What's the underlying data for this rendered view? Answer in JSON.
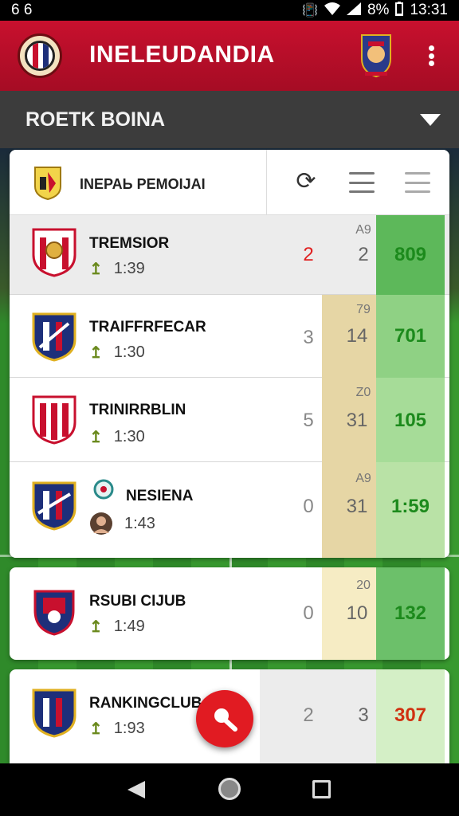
{
  "status_bar": {
    "left": "6 6",
    "battery": "8%",
    "time": "13:31",
    "icons": [
      "vibrate-icon",
      "wifi-icon",
      "signal-icon",
      "battery-icon"
    ]
  },
  "app_bar": {
    "title": "INELEUDANDIA",
    "logo": "club-logo",
    "crest": "crest-icon",
    "menu": "more-vert-icon"
  },
  "dropdown": {
    "label": "ROETK BOINA",
    "icon": "chevron-down-icon"
  },
  "card_header": {
    "title": "INEPAЬ PEMOIJAI",
    "icons": [
      "refresh-icon",
      "list-icon",
      "list-icon"
    ]
  },
  "rows": [
    {
      "name": "TREMSIOR",
      "meta": "1:39",
      "meta_icon": "hand-icon",
      "a": "2",
      "b": "2",
      "b_top": "A9",
      "c": "809"
    },
    {
      "name": "TRAIFFRFECAR",
      "meta": "1:30",
      "meta_icon": "hand-icon",
      "a": "3",
      "b": "14",
      "b_top": "79",
      "c": "701"
    },
    {
      "name": "TRINIRRBLIN",
      "meta": "1:30",
      "meta_icon": "hand-icon",
      "a": "5",
      "b": "31",
      "b_top": "Z0",
      "c": "105"
    },
    {
      "name": "NESIENA",
      "meta": "1:43",
      "meta_icon": "avatar",
      "a": "0",
      "b": "31",
      "b_top": "A9",
      "c": "1:59"
    }
  ],
  "solo_rows": [
    {
      "name": "RSUBI CIJUB",
      "meta": "1:49",
      "meta_icon": "hand-icon",
      "a": "0",
      "b": "10",
      "b_top": "20",
      "c": "132"
    },
    {
      "name": "RANKINGCLUB",
      "meta": "1:93",
      "meta_icon": "hand-icon",
      "a": "2",
      "b": "3",
      "b_top": "",
      "c": "307"
    }
  ],
  "colors": {
    "brand": "#c8102e",
    "accent_green": "#8fd184",
    "accent_tan": "#e6d6a5",
    "fab": "#e11b22"
  }
}
